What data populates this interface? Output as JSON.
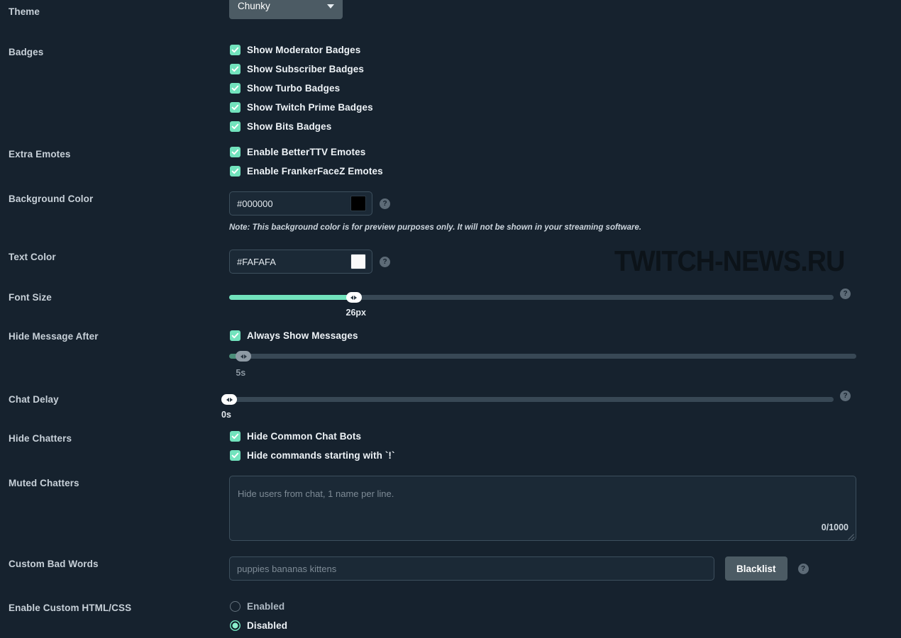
{
  "watermark": {
    "text": "TWITCH-NEWS.RU"
  },
  "rows": {
    "theme": {
      "label": "Theme",
      "selected": "Chunky",
      "caret_icon": "chevron-down-icon"
    },
    "badges": {
      "label": "Badges",
      "options": [
        {
          "label": "Show Moderator Badges",
          "checked": true
        },
        {
          "label": "Show Subscriber Badges",
          "checked": true
        },
        {
          "label": "Show Turbo Badges",
          "checked": true
        },
        {
          "label": "Show Twitch Prime Badges",
          "checked": true
        },
        {
          "label": "Show Bits Badges",
          "checked": true
        }
      ]
    },
    "extra_emotes": {
      "label": "Extra Emotes",
      "options": [
        {
          "label": "Enable BetterTTV Emotes",
          "checked": true
        },
        {
          "label": "Enable FrankerFaceZ Emotes",
          "checked": true
        }
      ]
    },
    "background_color": {
      "label": "Background Color",
      "value": "#000000",
      "swatch": "#000000",
      "help_icon": "help-circle-icon",
      "note": "Note: This background color is for preview purposes only. It will not be shown in your streaming software."
    },
    "text_color": {
      "label": "Text Color",
      "value": "#FAFAFA",
      "swatch": "#FAFAFA",
      "help_icon": "help-circle-icon"
    },
    "font_size": {
      "label": "Font Size",
      "value": "26px",
      "percent": 20.6,
      "help_icon": "help-circle-icon"
    },
    "hide_message_after": {
      "label": "Hide Message After",
      "checkbox": {
        "label": "Always Show Messages",
        "checked": true
      },
      "value": "5s",
      "percent": 2.3,
      "disabled": true
    },
    "chat_delay": {
      "label": "Chat Delay",
      "value": "0s",
      "percent": 0,
      "help_icon": "help-circle-icon"
    },
    "hide_chatters": {
      "label": "Hide Chatters",
      "options": [
        {
          "label": "Hide Common Chat Bots",
          "checked": true
        },
        {
          "label": "Hide commands starting with `!`",
          "checked": true
        }
      ]
    },
    "muted_chatters": {
      "label": "Muted Chatters",
      "placeholder": "Hide users from chat, 1 name per line.",
      "value": "",
      "counter": "0/1000"
    },
    "custom_bad_words": {
      "label": "Custom Bad Words",
      "placeholder": "puppies bananas kittens",
      "value": "",
      "button": "Blacklist",
      "help_icon": "help-circle-icon"
    },
    "enable_custom_html_css": {
      "label": "Enable Custom HTML/CSS",
      "options": [
        {
          "label": "Enabled",
          "selected": false
        },
        {
          "label": "Disabled",
          "selected": true
        }
      ]
    }
  },
  "colors": {
    "background": "#16222e",
    "accent": "#72e3bd",
    "text": "#eef3f7",
    "muted": "#7e8b96",
    "control": "#4c5b64"
  }
}
